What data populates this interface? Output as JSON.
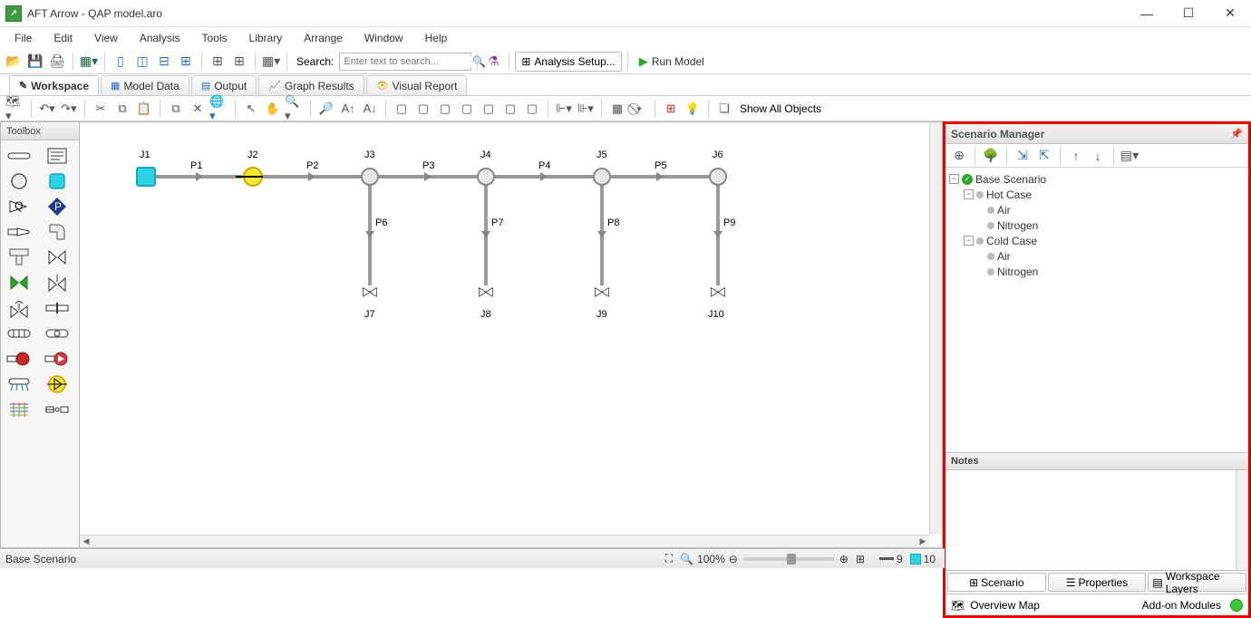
{
  "title": "AFT Arrow - QAP model.aro",
  "menu": [
    "File",
    "Edit",
    "View",
    "Analysis",
    "Tools",
    "Library",
    "Arrange",
    "Window",
    "Help"
  ],
  "search": {
    "label": "Search:",
    "placeholder": "Enter text to search..."
  },
  "analysis_setup": "Analysis Setup...",
  "run_model": "Run Model",
  "tabs": [
    {
      "label": "Workspace",
      "active": true
    },
    {
      "label": "Model Data",
      "active": false
    },
    {
      "label": "Output",
      "active": false
    },
    {
      "label": "Graph Results",
      "active": false
    },
    {
      "label": "Visual Report",
      "active": false
    }
  ],
  "show_all": "Show All Objects",
  "toolbox_title": "Toolbox",
  "scenario_panel": {
    "title": "Scenario Manager",
    "tree": {
      "root": "Base Scenario",
      "children": [
        {
          "label": "Hot Case",
          "children": [
            "Air",
            "Nitrogen"
          ]
        },
        {
          "label": "Cold Case",
          "children": [
            "Air",
            "Nitrogen"
          ]
        }
      ]
    },
    "notes_title": "Notes",
    "tabs": [
      "Scenario",
      "Properties",
      "Workspace Layers"
    ],
    "bottom": {
      "overview": "Overview Map",
      "addon": "Add-on Modules"
    }
  },
  "status": {
    "scenario": "Base Scenario",
    "zoom": "100%",
    "pipes": "9",
    "junctions": "10"
  },
  "canvas": {
    "junction_labels": [
      "J1",
      "J2",
      "J3",
      "J4",
      "J5",
      "J6",
      "J7",
      "J8",
      "J9",
      "J10"
    ],
    "pipe_labels": [
      "P1",
      "P2",
      "P3",
      "P4",
      "P5",
      "P6",
      "P7",
      "P8",
      "P9"
    ]
  }
}
